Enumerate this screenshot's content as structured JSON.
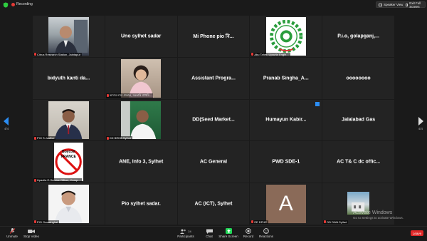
{
  "topbar": {
    "recording_label": "Recording",
    "speaker_view_label": "Speaker View",
    "exit_fullscreen_label": "Exit Full Screen"
  },
  "pagination": {
    "left": "4/4",
    "right": "4/4"
  },
  "tiles": [
    {
      "type": "photo",
      "caption": "Citrus Research Station, Jaintapur"
    },
    {
      "type": "name",
      "name": "Uno sylhet sadar"
    },
    {
      "type": "name",
      "name": "Mi Phone  pio বি..."
    },
    {
      "type": "logo",
      "caption": "Abu Taher, Upazila Engin..."
    },
    {
      "type": "name",
      "name": "P.i.o, golapganj,..."
    },
    {
      "type": "name",
      "name": "bidyuth kanti da..."
    },
    {
      "type": "photo",
      "caption": "আমার নামে প্রজান্ত, সরকারি প্রাথমি..."
    },
    {
      "type": "name",
      "name": "Assistant Progra..."
    },
    {
      "type": "name",
      "name": "Pranab  Singha_A..."
    },
    {
      "type": "name",
      "name": "oooooooo"
    },
    {
      "type": "photo",
      "caption": "PIO S.Justha"
    },
    {
      "type": "photo",
      "caption": "DD BRDB Sylhet"
    },
    {
      "type": "name",
      "name": "DD(Seed  Market..."
    },
    {
      "type": "name",
      "name": "Humayun  Kabir..."
    },
    {
      "type": "name",
      "name": "Jalalabad Gas"
    },
    {
      "type": "boycott",
      "caption": "Upazila E-Service Officer, Comp...",
      "sign_top": "Boycott",
      "sign_bottom": "FRANCE"
    },
    {
      "type": "name",
      "name": "ANE, Info 3, Sylhet"
    },
    {
      "type": "name",
      "name": "AC General"
    },
    {
      "type": "name",
      "name": "PWD SDE-1"
    },
    {
      "type": "name",
      "name": "AC T& C dc offic..."
    },
    {
      "type": "photo",
      "caption": "PIO Gowainghat"
    },
    {
      "type": "name",
      "name": "Pio sylhet sadar."
    },
    {
      "type": "name",
      "name": "AC (ICT), Sylhet"
    },
    {
      "type": "avatar",
      "letter": "A",
      "caption": "EE DPHE"
    },
    {
      "type": "photo",
      "caption": "DD DWA Sylhet"
    }
  ],
  "toolbar": {
    "unmute": "Unmute",
    "stop_video": "Stop Video",
    "participants": "Participants",
    "participants_count": "24",
    "chat": "Chat",
    "share_screen": "Share Screen",
    "record": "Record",
    "reactions": "Reactions",
    "leave": "Leave"
  },
  "watermark": {
    "line1": "Activate Windows",
    "line2": "Go to Settings to activate Windows."
  },
  "colors": {
    "share_green": "#23d959",
    "leave_red": "#e02828",
    "accent_blue": "#2b8df3",
    "avatar_bg": "#8a6a58"
  }
}
